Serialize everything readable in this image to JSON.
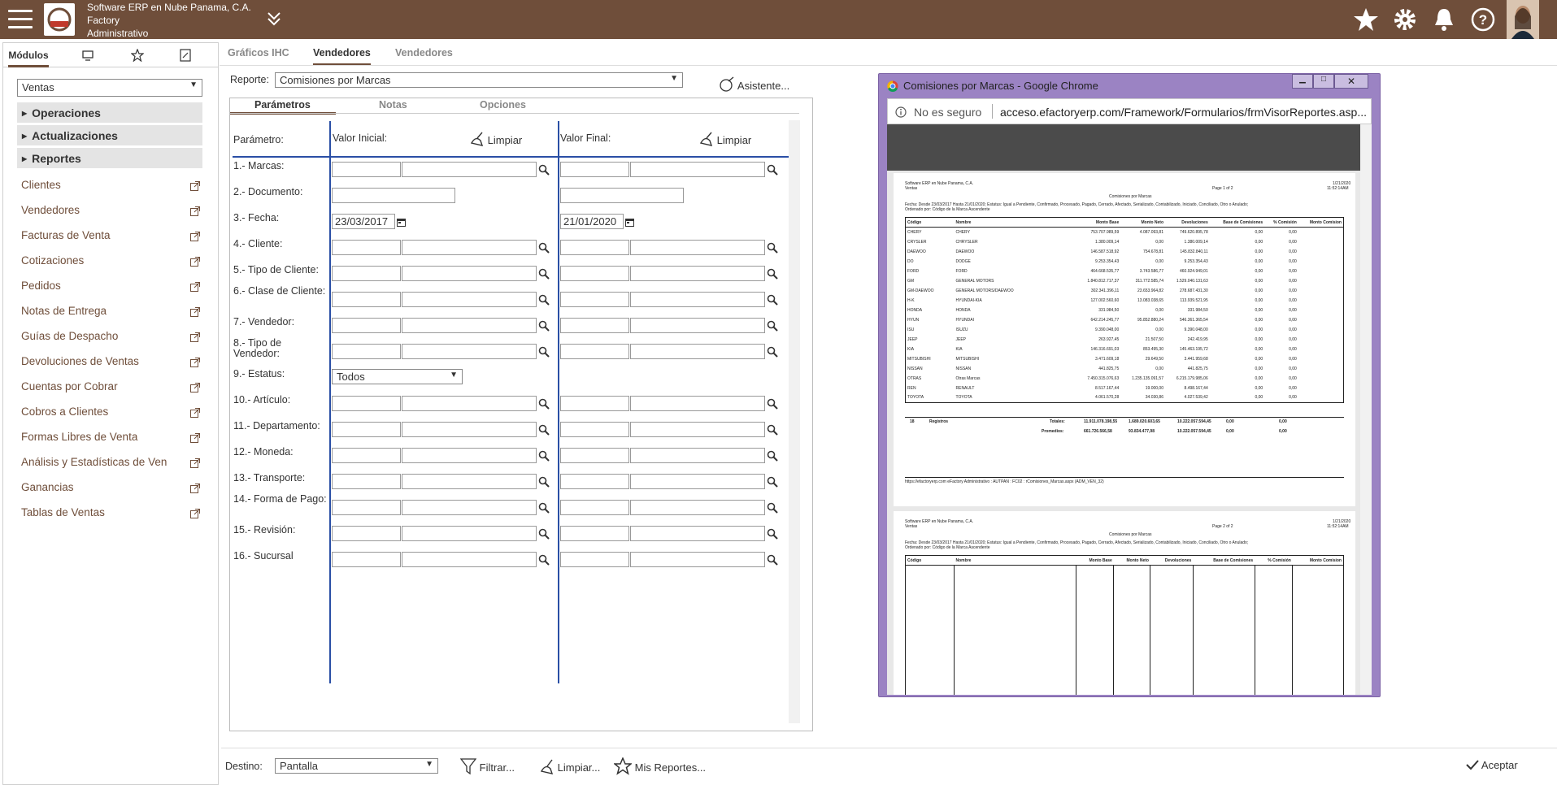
{
  "header": {
    "company": "Software ERP en Nube Panama, C.A.",
    "line2": "Factory",
    "line3": "Administrativo"
  },
  "left": {
    "tabs": [
      "Módulos"
    ],
    "module_select": "Ventas",
    "sections": [
      "Operaciones",
      "Actualizaciones",
      "Reportes"
    ],
    "items": [
      "Clientes",
      "Vendedores",
      "Facturas de Venta",
      "Cotizaciones",
      "Pedidos",
      "Notas de Entrega",
      "Guías de Despacho",
      "Devoluciones de Ventas",
      "Cuentas por Cobrar",
      "Cobros a Clientes",
      "Formas Libres de Venta",
      "Análisis y Estadísticas de Ven",
      "Ganancias",
      "Tablas de Ventas"
    ]
  },
  "main": {
    "tabs": [
      "Gráficos IHC",
      "Vendedores",
      "Vendedores"
    ],
    "report_label": "Reporte:",
    "report_value": "Comisiones por Marcas",
    "assistant": "Asistente...",
    "subtabs": [
      "Parámetros",
      "Notas",
      "Opciones"
    ],
    "col_param": "Parámetro:",
    "col_ini": "Valor Inicial:",
    "col_fin": "Valor Final:",
    "clear": "Limpiar",
    "params": [
      "1.- Marcas:",
      "2.- Documento:",
      "3.- Fecha:",
      "4.- Cliente:",
      "5.- Tipo de Cliente:",
      "6.- Clase de Cliente:",
      "7.- Vendedor:",
      "8.- Tipo de Vendedor:",
      "9.- Estatus:",
      "10.- Artículo:",
      "11.- Departamento:",
      "12.- Moneda:",
      "13.- Transporte:",
      "14.- Forma de Pago:",
      "15.- Revisión:",
      "16.- Sucursal"
    ],
    "date_ini": "23/03/2017",
    "date_fin": "21/01/2020",
    "estatus": "Todos"
  },
  "bottom": {
    "destino_label": "Destino:",
    "destino_value": "Pantalla",
    "filtrar": "Filtrar...",
    "limpiar": "Limpiar...",
    "mis_reportes": "Mis Reportes...",
    "aceptar": "Aceptar"
  },
  "popup": {
    "title": "Comisiones por Marcas - Google Chrome",
    "insecure": "No es seguro",
    "url": "acceso.efactoryerp.com/Framework/Formularios/frmVisorReportes.asp...",
    "report": {
      "company": "Software ERP en Nube Panama, C.A.",
      "module": "Ventas",
      "title": "Comisiones por Marcas",
      "date": "1/21/2020",
      "time": "11:52:14AM",
      "page1": "Page 1 of 2",
      "page2": "Page 2 of 2",
      "filter": "Fecha: Desde 23/03/2017  Hasta 21/01/2020; Estatus: Igual a Pendiente, Confirmado, Procesado, Pagado, Cerrado, Afectado, Serializado, Contabilizado, Iniciado, Conciliado, Otro o Anulado;",
      "order": "Ordenado por: Código de la Marca Ascendente",
      "headers": [
        "Código",
        "Nombre",
        "Monto Base",
        "Monto Neto",
        "Devoluciones",
        "Base de Comisiones",
        "% Comisión",
        "Monto Comision"
      ],
      "rows": [
        [
          "CHERY",
          "CHERY",
          "753.707.989,59",
          "4.087.093,81",
          "749.620.895,78",
          "0,00",
          "0,00"
        ],
        [
          "CRYSLER",
          "CHRYSLER",
          "1.380.009,14",
          "0,00",
          "1.380.009,14",
          "0,00",
          "0,00"
        ],
        [
          "DAEWOO",
          "DAEWOO",
          "146.587.518,92",
          "754.678,81",
          "145.832.840,11",
          "0,00",
          "0,00"
        ],
        [
          "DO",
          "DODGE",
          "9.253.354,43",
          "0,00",
          "9.253.354,43",
          "0,00",
          "0,00"
        ],
        [
          "FORD",
          "FORD",
          "464.668.535,77",
          "3.743.586,77",
          "460.924.949,01",
          "0,00",
          "0,00"
        ],
        [
          "GM",
          "GENERAL MOTORS",
          "1.840.812.717,37",
          "311.772.585,74",
          "1.529.040.131,63",
          "0,00",
          "0,00"
        ],
        [
          "GM-DAEWOO",
          "GENERAL MOTORS/DAEWOO",
          "302.341.396,11",
          "23.653.964,82",
          "278.687.431,30",
          "0,00",
          "0,00"
        ],
        [
          "H-K",
          "HYUNDAI-KIA",
          "127.002.560,60",
          "13.083.038,65",
          "113.939.521,95",
          "0,00",
          "0,00"
        ],
        [
          "HONDA",
          "HONDA",
          "331.984,50",
          "0,00",
          "331.984,50",
          "0,00",
          "0,00"
        ],
        [
          "HYUN",
          "HYUNDAI",
          "642.214.245,77",
          "95.852.880,24",
          "546.361.365,54",
          "0,00",
          "0,00"
        ],
        [
          "ISU",
          "ISUZU",
          "9.390.048,00",
          "0,00",
          "9.390.048,00",
          "0,00",
          "0,00"
        ],
        [
          "JEEP",
          "JEEP",
          "263.927,45",
          "21.507,50",
          "242.419,95",
          "0,00",
          "0,00"
        ],
        [
          "KIA",
          "KIA",
          "146.316.691,03",
          "853.495,30",
          "145.463.195,72",
          "0,00",
          "0,00"
        ],
        [
          "MITSUBISHI",
          "MITSUBISHI",
          "3.471.609,18",
          "29.649,50",
          "3.441.959,68",
          "0,00",
          "0,00"
        ],
        [
          "NISSAN",
          "NISSAN",
          "441.825,75",
          "0,00",
          "441.825,75",
          "0,00",
          "0,00"
        ],
        [
          "OTRAS",
          "Otras Marcas",
          "7.450.315.076,63",
          "1.235.135.091,57",
          "6.215.179.985,06",
          "0,00",
          "0,00"
        ],
        [
          "REN",
          "RENAULT",
          "8.517.167,44",
          "19.000,00",
          "8.498.167,44",
          "0,00",
          "0,00"
        ],
        [
          "TOYOTA",
          "TOYOTA",
          "4.061.570,28",
          "34.030,86",
          "4.027.539,42",
          "0,00",
          "0,00"
        ]
      ],
      "count": "18",
      "count_label": "Registros",
      "totals_label": "Totales:",
      "totals": [
        "11.911.078.198,55",
        "1.689.020.603,65",
        "10.222.057.594,45",
        "0,00",
        "0,00"
      ],
      "avg_label": "Promedios:",
      "avgs": [
        "661.726.566,58",
        "93.834.477,98",
        "10.222.057.594,45",
        "0,00",
        "0,00"
      ],
      "footer": "https://efactoryerp.com        eFactory Administrativo  :  AUTPAN  :  FC02  :  rComisiones_Marcas.aspx (ADM_VEN_32)"
    }
  }
}
